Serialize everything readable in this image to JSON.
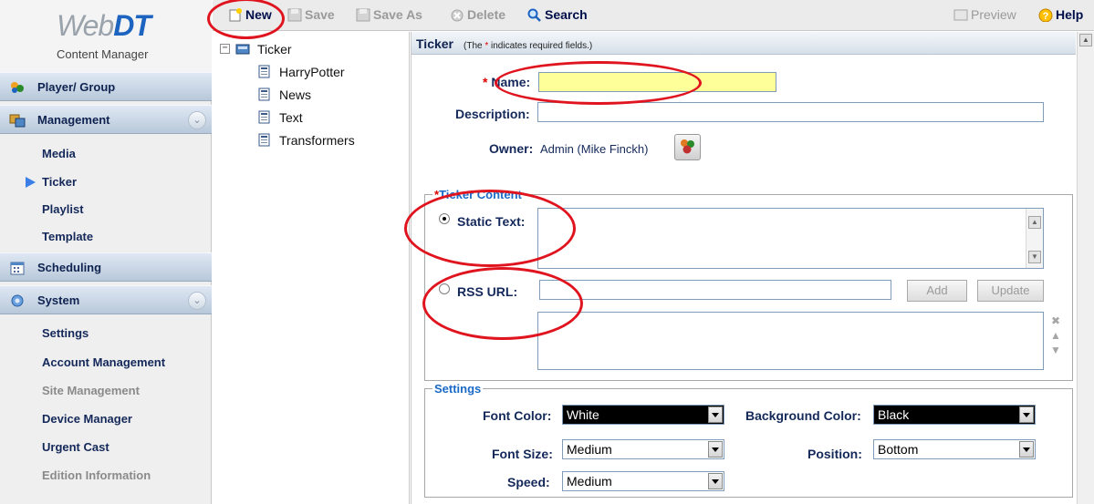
{
  "logo": {
    "text_web": "Web",
    "text_dt": "DT",
    "subtitle": "Content Manager"
  },
  "nav": {
    "player_group": "Player/ Group",
    "management": "Management",
    "media": "Media",
    "ticker": "Ticker",
    "playlist": "Playlist",
    "template": "Template",
    "scheduling": "Scheduling",
    "system": "System",
    "settings": "Settings",
    "account_management": "Account Management",
    "site_management": "Site Management",
    "device_manager": "Device Manager",
    "urgent_cast": "Urgent Cast",
    "edition_information": "Edition Information"
  },
  "toolbar": {
    "new": "New",
    "save": "Save",
    "save_as": "Save As",
    "delete": "Delete",
    "search": "Search",
    "preview": "Preview",
    "help": "Help"
  },
  "tree": {
    "root": "Ticker",
    "toggle": "−",
    "children": [
      "HarryPotter",
      "News",
      "Text",
      "Transformers"
    ]
  },
  "panel": {
    "title": "Ticker",
    "note_before": "(The ",
    "note_star": "*",
    "note_after": " indicates required fields.)",
    "name_label": "Name:",
    "name_value": "",
    "description_label": "Description:",
    "description_value": "",
    "owner_label": "Owner:",
    "owner_value": "Admin (Mike Finckh)",
    "required_star": "*"
  },
  "ticker_content": {
    "legend": "Ticker Content",
    "static_text_label": "Static Text:",
    "static_text_selected": true,
    "rss_url_label": "RSS URL:",
    "rss_url_value": "",
    "add_label": "Add",
    "update_label": "Update"
  },
  "settings": {
    "legend": "Settings",
    "font_color_label": "Font Color:",
    "font_color_value": "White",
    "background_color_label": "Background Color:",
    "background_color_value": "Black",
    "font_size_label": "Font Size:",
    "font_size_value": "Medium",
    "position_label": "Position:",
    "position_value": "Bottom",
    "speed_label": "Speed:",
    "speed_value": "Medium"
  },
  "colors": {
    "annotation": "#e0141e",
    "accent": "#1b6ac7",
    "nav_text": "#14285a",
    "required": "#dd0000"
  }
}
